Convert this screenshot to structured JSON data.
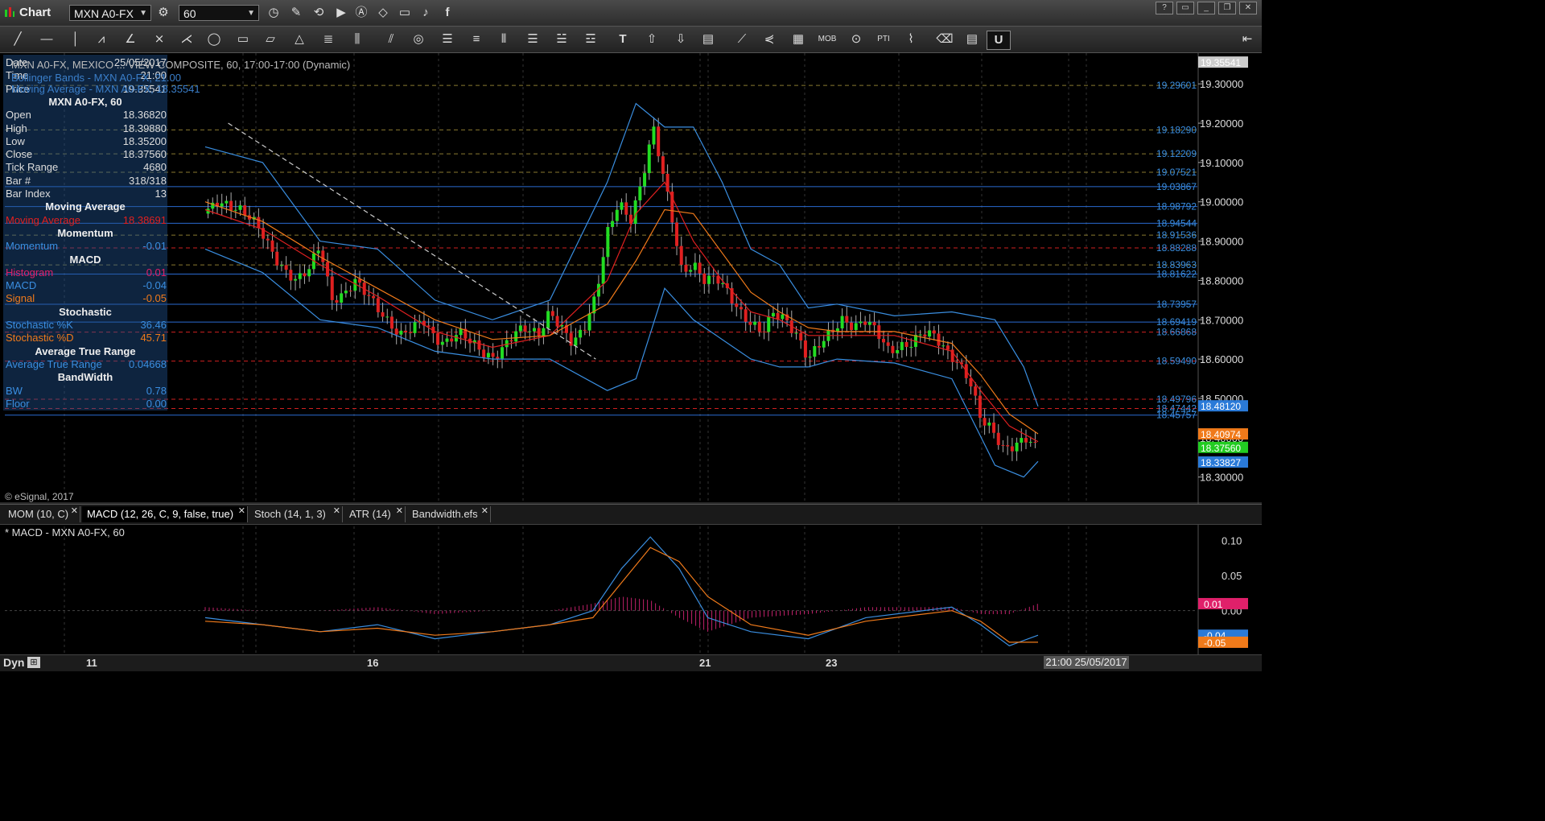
{
  "app": {
    "title": "Chart",
    "symbol": "MXN A0-FX",
    "interval": "60"
  },
  "legend": {
    "chart": "MXN A0-FX, MEXICO ... VIEW COMPOSITE, 60, 17:00-17:00 (Dynamic)",
    "bollinger": "Bollinger Bands - MXN A0-FX, 21.00",
    "moving_average": "Moving Average - MXN A0-FX, 18.35541"
  },
  "data_window": {
    "rows_top": [
      {
        "k": "Date",
        "v": "25/05/2017",
        "color": "#dddddd"
      },
      {
        "k": "Time",
        "v": "21:00",
        "color": "#dddddd"
      },
      {
        "k": "Price",
        "v": "19.35541",
        "color": "#dddddd"
      }
    ],
    "symbol_header": "MXN A0-FX, 60",
    "rows_ohlc": [
      {
        "k": "Open",
        "v": "18.36820",
        "color": "#dddddd"
      },
      {
        "k": "High",
        "v": "18.39880",
        "color": "#dddddd"
      },
      {
        "k": "Low",
        "v": "18.35200",
        "color": "#dddddd"
      },
      {
        "k": "Close",
        "v": "18.37560",
        "color": "#dddddd"
      },
      {
        "k": "Tick Range",
        "v": "4680",
        "color": "#dddddd"
      },
      {
        "k": "Bar #",
        "v": "318/318",
        "color": "#dddddd"
      },
      {
        "k": "Bar Index",
        "v": "13",
        "color": "#dddddd"
      }
    ],
    "ma_header": "Moving Average",
    "ma_row": {
      "k": "Moving Average",
      "v": "18.38691",
      "color": "#e02020"
    },
    "mom_header": "Momentum",
    "mom_row": {
      "k": "Momentum",
      "v": "-0.01",
      "color": "#3a8ee0"
    },
    "macd_header": "MACD",
    "macd_rows": [
      {
        "k": "Histogram",
        "v": "0.01",
        "color": "#e0206a"
      },
      {
        "k": "MACD",
        "v": "-0.04",
        "color": "#3a8ee0"
      },
      {
        "k": "Signal",
        "v": "-0.05",
        "color": "#f07a1a"
      }
    ],
    "stoch_header": "Stochastic",
    "stoch_rows": [
      {
        "k": "Stochastic %K",
        "v": "36.46",
        "color": "#3a8ee0"
      },
      {
        "k": "Stochastic %D",
        "v": "45.71",
        "color": "#f07a1a"
      }
    ],
    "atr_header": "Average True Range",
    "atr_row": {
      "k": "Average True Range",
      "v": "0.04668",
      "color": "#3a8ee0"
    },
    "bw_header": "BandWidth",
    "bw_rows": [
      {
        "k": "BW",
        "v": "0.78",
        "color": "#3a8ee0"
      },
      {
        "k": "Floor",
        "v": "0.00",
        "color": "#3a8ee0"
      }
    ]
  },
  "copyright": "© eSignal, 2017",
  "tabs": [
    {
      "label": "MOM (10, C)",
      "active": false
    },
    {
      "label": "MACD (12, 26, C, 9, false, true)",
      "active": true
    },
    {
      "label": "Stoch (14, 1, 3)",
      "active": false
    },
    {
      "label": "ATR (14)",
      "active": false
    },
    {
      "label": "Bandwidth.efs",
      "active": false
    }
  ],
  "macd_legend": "* MACD - MXN A0-FX, 60",
  "bottom": {
    "dyn": "Dyn",
    "cursor_date": "21:00 25/05/2017",
    "dates": [
      "11",
      "16",
      "21",
      "23"
    ]
  },
  "colors": {
    "up": "#22dd22",
    "down": "#e02020",
    "bb": "#3a8ee0",
    "ma": "#e02020",
    "ma2": "#f07a1a",
    "hline": "#2a6ad0",
    "resist": "#d02020"
  },
  "chart_data": [
    {
      "type": "candlestick",
      "symbol": "MXN A0-FX",
      "interval": "60",
      "y_ticks": [
        "18.30000",
        "18.40000",
        "18.50000",
        "18.60000",
        "18.70000",
        "18.80000",
        "18.90000",
        "19.00000",
        "19.10000",
        "19.20000",
        "19.30000"
      ],
      "ylim": [
        18.24,
        19.37
      ],
      "x_ticks": [
        "11",
        "16",
        "21",
        "23"
      ],
      "price_labels": [
        {
          "label": "19.35541",
          "value": 19.35541,
          "color": "#cccccc",
          "style": "tag"
        },
        {
          "label": "19.29601",
          "value": 19.29601,
          "color": "#3a8ee0",
          "style": "text"
        },
        {
          "label": "19.18290",
          "value": 19.1829,
          "color": "#3a8ee0",
          "style": "text"
        },
        {
          "label": "19.12209",
          "value": 19.12209,
          "color": "#3a8ee0",
          "style": "text"
        },
        {
          "label": "19.07521",
          "value": 19.07521,
          "color": "#3a8ee0",
          "style": "text"
        },
        {
          "label": "19.03867",
          "value": 19.03867,
          "color": "#3a8ee0",
          "style": "text"
        },
        {
          "label": "18.98792",
          "value": 18.98792,
          "color": "#3a8ee0",
          "style": "text"
        },
        {
          "label": "18.94544",
          "value": 18.94544,
          "color": "#3a8ee0",
          "style": "text"
        },
        {
          "label": "18.91536",
          "value": 18.91536,
          "color": "#3a8ee0",
          "style": "text"
        },
        {
          "label": "18.88288",
          "value": 18.88288,
          "color": "#3a8ee0",
          "style": "text"
        },
        {
          "label": "18.83963",
          "value": 18.83963,
          "color": "#3a8ee0",
          "style": "text"
        },
        {
          "label": "18.81622",
          "value": 18.81622,
          "color": "#3a8ee0",
          "style": "text"
        },
        {
          "label": "18.73957",
          "value": 18.73957,
          "color": "#3a8ee0",
          "style": "text"
        },
        {
          "label": "18.69419",
          "value": 18.69419,
          "color": "#3a8ee0",
          "style": "text"
        },
        {
          "label": "18.66868",
          "value": 18.66868,
          "color": "#3a8ee0",
          "style": "text"
        },
        {
          "label": "18.59490",
          "value": 18.5949,
          "color": "#3a8ee0",
          "style": "text"
        },
        {
          "label": "18.49796",
          "value": 18.49796,
          "color": "#3a8ee0",
          "style": "text"
        },
        {
          "label": "18.47442",
          "value": 18.47442,
          "color": "#3a8ee0",
          "style": "text"
        },
        {
          "label": "18.45757",
          "value": 18.45757,
          "color": "#3a8ee0",
          "style": "text"
        },
        {
          "label": "18.48120",
          "value": 18.4812,
          "color": "#2a7ad8",
          "style": "tag"
        },
        {
          "label": "18.40974",
          "value": 18.40974,
          "color": "#f07a1a",
          "style": "tag"
        },
        {
          "label": "18.37560",
          "value": 18.3756,
          "color": "#22cc22",
          "style": "tag"
        },
        {
          "label": "18.33827",
          "value": 18.33827,
          "color": "#2a7ad8",
          "style": "tag"
        }
      ],
      "horizontal_lines": [
        {
          "value": 19.29601,
          "color": "#8a7a30",
          "dash": true
        },
        {
          "value": 19.1829,
          "color": "#8a7a30",
          "dash": true
        },
        {
          "value": 19.12209,
          "color": "#8a7a30",
          "dash": true
        },
        {
          "value": 19.07521,
          "color": "#8a7a30",
          "dash": true
        },
        {
          "value": 19.03867,
          "color": "#2a6ad0",
          "dash": false
        },
        {
          "value": 18.98792,
          "color": "#2a6ad0",
          "dash": false
        },
        {
          "value": 18.94544,
          "color": "#2a6ad0",
          "dash": false
        },
        {
          "value": 18.91536,
          "color": "#8a7a30",
          "dash": true
        },
        {
          "value": 18.88288,
          "color": "#d02020",
          "dash": true
        },
        {
          "value": 18.83963,
          "color": "#8a7a30",
          "dash": true
        },
        {
          "value": 18.81622,
          "color": "#2a6ad0",
          "dash": false
        },
        {
          "value": 18.73957,
          "color": "#2a6ad0",
          "dash": false
        },
        {
          "value": 18.69419,
          "color": "#2a6ad0",
          "dash": false
        },
        {
          "value": 18.66868,
          "color": "#d02020",
          "dash": true
        },
        {
          "value": 18.5949,
          "color": "#d02020",
          "dash": true
        },
        {
          "value": 18.49796,
          "color": "#d02020",
          "dash": true
        },
        {
          "value": 18.47442,
          "color": "#d02020",
          "dash": true
        },
        {
          "value": 18.45757,
          "color": "#2a6ad0",
          "dash": false
        }
      ],
      "close_path": [
        [
          0,
          18.97
        ],
        [
          4,
          19.0
        ],
        [
          8,
          18.99
        ],
        [
          12,
          18.98
        ],
        [
          16,
          18.96
        ],
        [
          20,
          18.92
        ],
        [
          24,
          18.86
        ],
        [
          28,
          18.82
        ],
        [
          32,
          18.8
        ],
        [
          36,
          18.83
        ],
        [
          40,
          18.89
        ],
        [
          44,
          18.75
        ],
        [
          48,
          18.76
        ],
        [
          52,
          18.8
        ],
        [
          56,
          18.77
        ],
        [
          60,
          18.73
        ],
        [
          64,
          18.69
        ],
        [
          68,
          18.66
        ],
        [
          72,
          18.68
        ],
        [
          76,
          18.7
        ],
        [
          80,
          18.65
        ],
        [
          84,
          18.64
        ],
        [
          88,
          18.67
        ],
        [
          92,
          18.65
        ],
        [
          96,
          18.62
        ],
        [
          100,
          18.6
        ],
        [
          104,
          18.63
        ],
        [
          108,
          18.67
        ],
        [
          112,
          18.68
        ],
        [
          116,
          18.66
        ],
        [
          120,
          18.72
        ],
        [
          124,
          18.68
        ],
        [
          128,
          18.64
        ],
        [
          132,
          18.68
        ],
        [
          136,
          18.76
        ],
        [
          140,
          18.92
        ],
        [
          144,
          19.0
        ],
        [
          148,
          18.95
        ],
        [
          152,
          19.05
        ],
        [
          156,
          19.19
        ],
        [
          158,
          19.12
        ],
        [
          162,
          18.98
        ],
        [
          166,
          18.82
        ],
        [
          170,
          18.84
        ],
        [
          174,
          18.8
        ],
        [
          178,
          18.81
        ],
        [
          182,
          18.77
        ],
        [
          186,
          18.72
        ],
        [
          190,
          18.69
        ],
        [
          194,
          18.67
        ],
        [
          198,
          18.72
        ],
        [
          202,
          18.7
        ],
        [
          206,
          18.66
        ],
        [
          210,
          18.6
        ],
        [
          214,
          18.64
        ],
        [
          218,
          18.67
        ],
        [
          222,
          18.7
        ],
        [
          226,
          18.68
        ],
        [
          230,
          18.7
        ],
        [
          234,
          18.67
        ],
        [
          238,
          18.62
        ],
        [
          242,
          18.63
        ],
        [
          246,
          18.64
        ],
        [
          250,
          18.67
        ],
        [
          254,
          18.66
        ],
        [
          258,
          18.62
        ],
        [
          262,
          18.59
        ],
        [
          266,
          18.55
        ],
        [
          270,
          18.45
        ],
        [
          274,
          18.42
        ],
        [
          278,
          18.37
        ],
        [
          282,
          18.38
        ],
        [
          286,
          18.4
        ],
        [
          290,
          18.37
        ]
      ],
      "bollinger_upper": [
        [
          0,
          19.14
        ],
        [
          20,
          19.1
        ],
        [
          40,
          18.9
        ],
        [
          60,
          18.88
        ],
        [
          80,
          18.75
        ],
        [
          100,
          18.7
        ],
        [
          120,
          18.75
        ],
        [
          140,
          19.05
        ],
        [
          150,
          19.25
        ],
        [
          160,
          19.19
        ],
        [
          170,
          19.19
        ],
        [
          180,
          19.05
        ],
        [
          190,
          18.88
        ],
        [
          200,
          18.84
        ],
        [
          210,
          18.73
        ],
        [
          220,
          18.74
        ],
        [
          240,
          18.71
        ],
        [
          260,
          18.72
        ],
        [
          275,
          18.7
        ],
        [
          285,
          18.58
        ],
        [
          290,
          18.48
        ]
      ],
      "bollinger_lower": [
        [
          0,
          18.88
        ],
        [
          20,
          18.82
        ],
        [
          40,
          18.7
        ],
        [
          60,
          18.68
        ],
        [
          80,
          18.62
        ],
        [
          100,
          18.6
        ],
        [
          120,
          18.6
        ],
        [
          140,
          18.52
        ],
        [
          150,
          18.55
        ],
        [
          160,
          18.78
        ],
        [
          170,
          18.7
        ],
        [
          180,
          18.65
        ],
        [
          190,
          18.6
        ],
        [
          200,
          18.58
        ],
        [
          210,
          18.58
        ],
        [
          220,
          18.6
        ],
        [
          240,
          18.59
        ],
        [
          260,
          18.55
        ],
        [
          275,
          18.33
        ],
        [
          285,
          18.3
        ],
        [
          290,
          18.34
        ]
      ],
      "moving_average": [
        [
          0,
          18.98
        ],
        [
          20,
          18.93
        ],
        [
          40,
          18.84
        ],
        [
          60,
          18.76
        ],
        [
          80,
          18.67
        ],
        [
          100,
          18.63
        ],
        [
          120,
          18.66
        ],
        [
          140,
          18.8
        ],
        [
          150,
          18.97
        ],
        [
          160,
          19.05
        ],
        [
          170,
          18.9
        ],
        [
          180,
          18.8
        ],
        [
          190,
          18.72
        ],
        [
          200,
          18.7
        ],
        [
          210,
          18.66
        ],
        [
          220,
          18.66
        ],
        [
          240,
          18.66
        ],
        [
          260,
          18.62
        ],
        [
          270,
          18.52
        ],
        [
          280,
          18.43
        ],
        [
          290,
          18.39
        ]
      ],
      "signal_ma": [
        [
          0,
          19.0
        ],
        [
          20,
          18.95
        ],
        [
          40,
          18.86
        ],
        [
          60,
          18.78
        ],
        [
          80,
          18.7
        ],
        [
          100,
          18.65
        ],
        [
          120,
          18.66
        ],
        [
          140,
          18.74
        ],
        [
          150,
          18.85
        ],
        [
          160,
          18.98
        ],
        [
          170,
          18.97
        ],
        [
          180,
          18.87
        ],
        [
          190,
          18.77
        ],
        [
          200,
          18.72
        ],
        [
          210,
          18.68
        ],
        [
          220,
          18.67
        ],
        [
          240,
          18.67
        ],
        [
          260,
          18.64
        ],
        [
          270,
          18.56
        ],
        [
          280,
          18.46
        ],
        [
          290,
          18.41
        ]
      ],
      "trendline": [
        [
          8,
          19.2
        ],
        [
          136,
          18.6
        ]
      ]
    },
    {
      "type": "macd",
      "title": "* MACD - MXN A0-FX, 60",
      "y_ticks": [
        "0.10",
        "0.05",
        "0.00"
      ],
      "ylim": [
        -0.06,
        0.12
      ],
      "labels": [
        {
          "label": "0.01",
          "value": 0.01,
          "color": "#e0206a"
        },
        {
          "label": "-0.04",
          "value": -0.035,
          "color": "#2a7ad8"
        },
        {
          "label": "-0.05",
          "value": -0.045,
          "color": "#f07a1a"
        }
      ],
      "macd": [
        [
          0,
          -0.01
        ],
        [
          20,
          -0.02
        ],
        [
          40,
          -0.03
        ],
        [
          60,
          -0.02
        ],
        [
          80,
          -0.04
        ],
        [
          100,
          -0.03
        ],
        [
          120,
          -0.02
        ],
        [
          135,
          0.0
        ],
        [
          145,
          0.06
        ],
        [
          155,
          0.105
        ],
        [
          165,
          0.06
        ],
        [
          175,
          -0.01
        ],
        [
          190,
          -0.03
        ],
        [
          210,
          -0.04
        ],
        [
          230,
          -0.01
        ],
        [
          250,
          0.0
        ],
        [
          260,
          0.005
        ],
        [
          270,
          -0.02
        ],
        [
          280,
          -0.05
        ],
        [
          290,
          -0.035
        ]
      ],
      "signal": [
        [
          0,
          -0.015
        ],
        [
          20,
          -0.02
        ],
        [
          40,
          -0.03
        ],
        [
          60,
          -0.025
        ],
        [
          80,
          -0.035
        ],
        [
          100,
          -0.03
        ],
        [
          120,
          -0.02
        ],
        [
          135,
          -0.01
        ],
        [
          145,
          0.04
        ],
        [
          155,
          0.09
        ],
        [
          165,
          0.07
        ],
        [
          175,
          0.02
        ],
        [
          190,
          -0.02
        ],
        [
          210,
          -0.035
        ],
        [
          230,
          -0.015
        ],
        [
          250,
          -0.005
        ],
        [
          260,
          0.0
        ],
        [
          270,
          -0.015
        ],
        [
          280,
          -0.045
        ],
        [
          290,
          -0.045
        ]
      ]
    }
  ]
}
